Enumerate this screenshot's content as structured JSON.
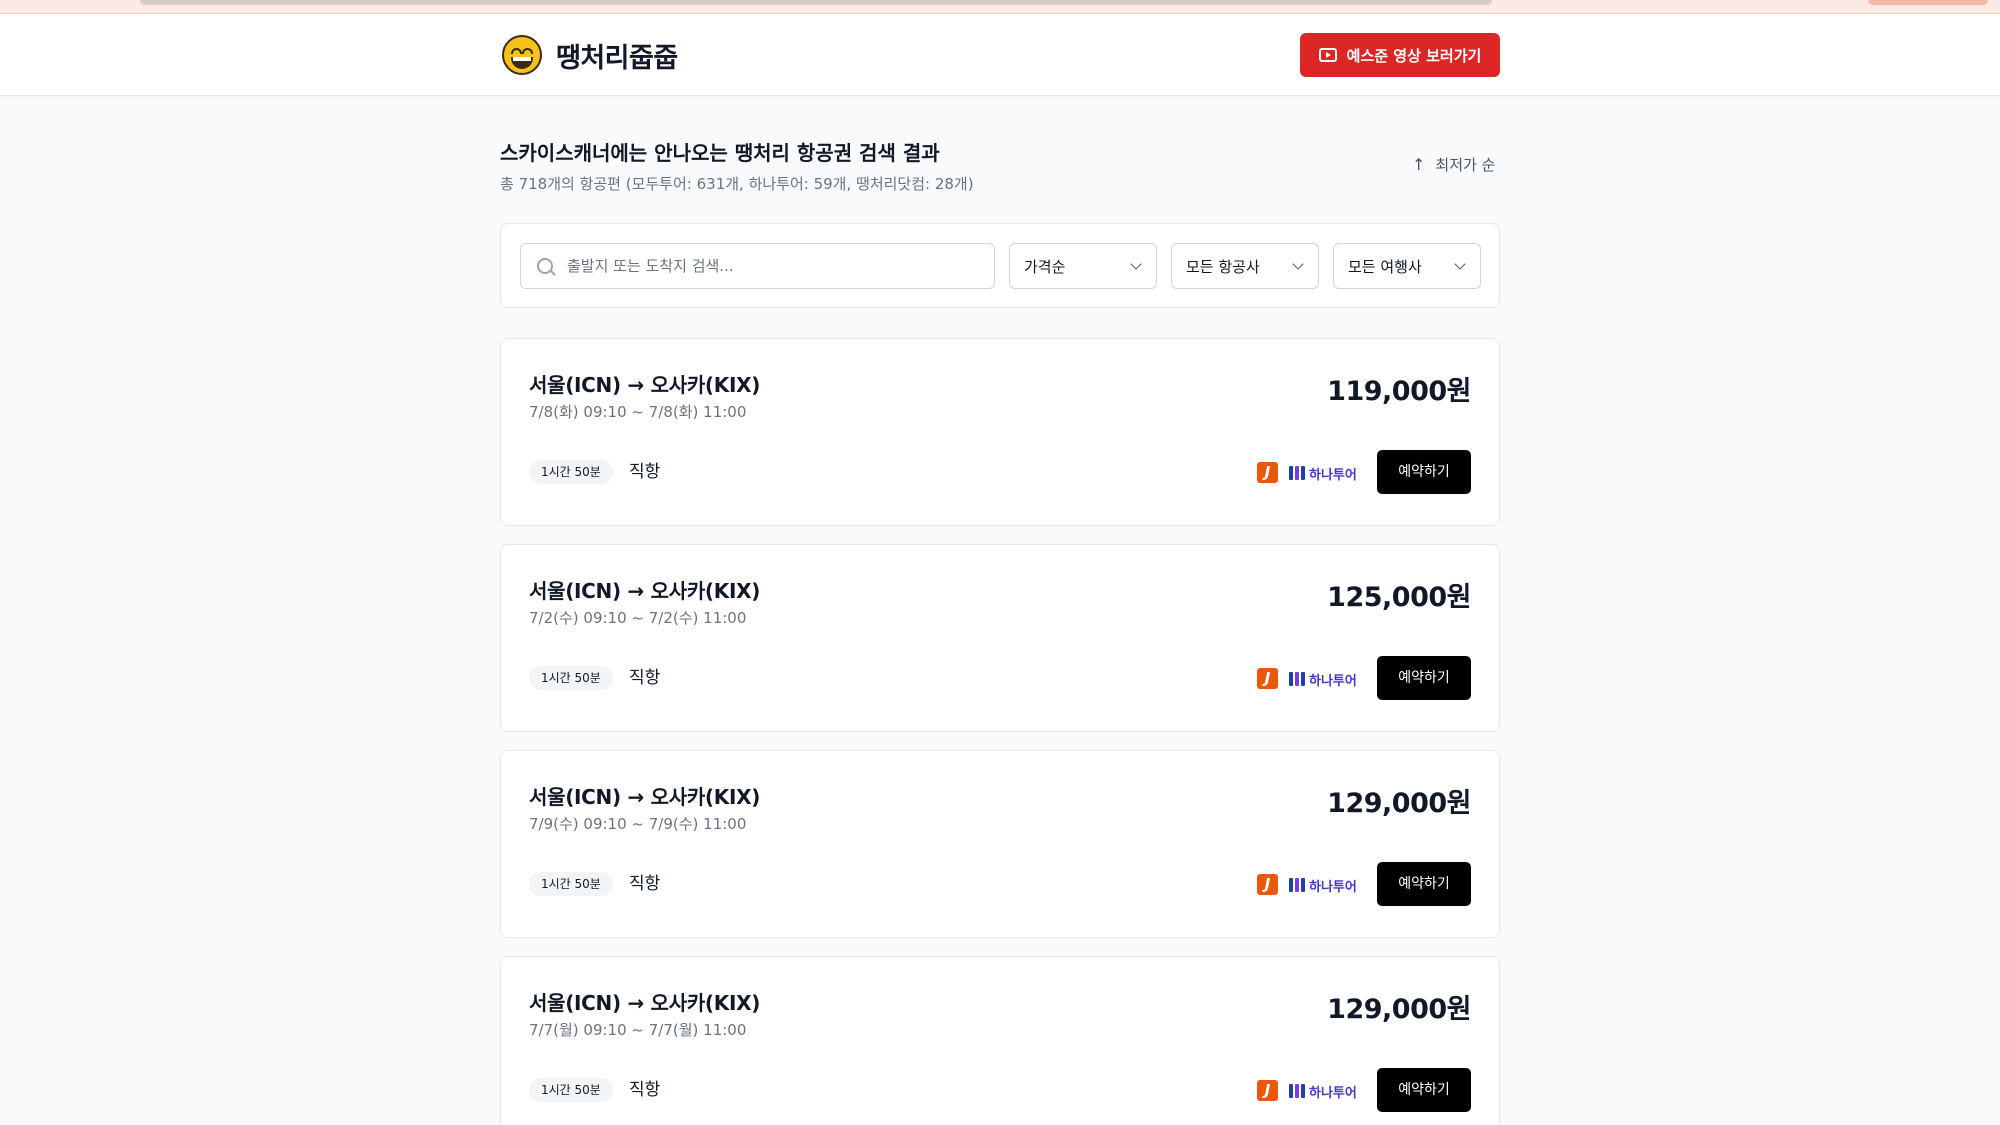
{
  "header": {
    "logo_text": "땡처리줍줍",
    "video_button_label": "예스준 영상 보러가기"
  },
  "main": {
    "title": "스카이스캐너에는 안나오는 땡처리 항공권 검색 결과",
    "subtitle": "총 718개의 항공편 (모두투어: 631개, 하나투어: 59개, 땡처리닷컴: 28개)",
    "sort_toggle_label": "최저가 순"
  },
  "filters": {
    "search_placeholder": "출발지 또는 도착지 검색...",
    "search_value": "",
    "sort_select": "가격순",
    "airline_select": "모든 항공사",
    "agency_select": "모든 여행사"
  },
  "vendors": {
    "modu_letter": "J",
    "hana_label": "하나투어"
  },
  "flights": [
    {
      "route": "서울(ICN) → 오사카(KIX)",
      "times": "7/8(화) 09:10 ~ 7/8(화) 11:00",
      "price": "119,000원",
      "duration": "1시간 50분",
      "stops": "직항",
      "book_label": "예약하기"
    },
    {
      "route": "서울(ICN) → 오사카(KIX)",
      "times": "7/2(수) 09:10 ~ 7/2(수) 11:00",
      "price": "125,000원",
      "duration": "1시간 50분",
      "stops": "직항",
      "book_label": "예약하기"
    },
    {
      "route": "서울(ICN) → 오사카(KIX)",
      "times": "7/9(수) 09:10 ~ 7/9(수) 11:00",
      "price": "129,000원",
      "duration": "1시간 50분",
      "stops": "직항",
      "book_label": "예약하기"
    },
    {
      "route": "서울(ICN) → 오사카(KIX)",
      "times": "7/7(월) 09:10 ~ 7/7(월) 11:00",
      "price": "129,000원",
      "duration": "1시간 50분",
      "stops": "직항",
      "book_label": "예약하기"
    }
  ],
  "colors": {
    "brand_red": "#dc2626",
    "modu_orange": "#ea580c",
    "hana_indigo": "#4338ca",
    "book_black": "#000000"
  }
}
